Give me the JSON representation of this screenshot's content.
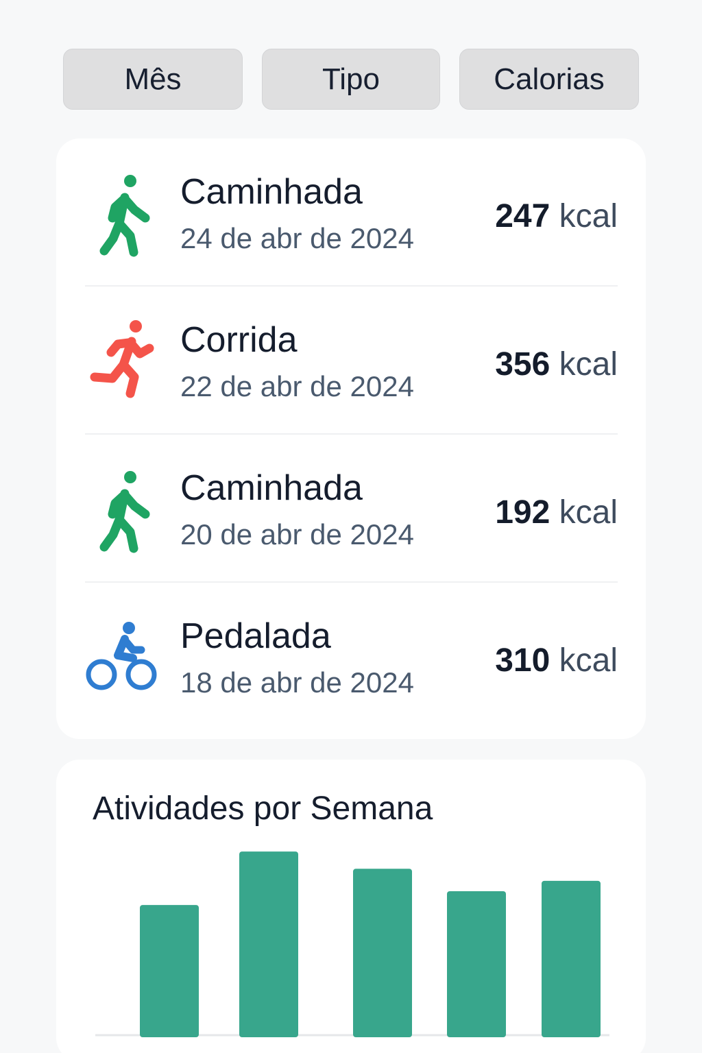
{
  "filters": [
    {
      "label": "Mês"
    },
    {
      "label": "Tipo"
    },
    {
      "label": "Calorias"
    }
  ],
  "activities": [
    {
      "type": "Caminhada",
      "date": "24 de abr de 2024",
      "kcal_value": "247",
      "kcal_unit": "kcal",
      "icon": "walking-icon",
      "color": "#1fa463"
    },
    {
      "type": "Corrida",
      "date": "22 de abr de 2024",
      "kcal_value": "356",
      "kcal_unit": "kcal",
      "icon": "running-icon",
      "color": "#f4544a"
    },
    {
      "type": "Caminhada",
      "date": "20 de abr de 2024",
      "kcal_value": "192",
      "kcal_unit": "kcal",
      "icon": "walking-icon",
      "color": "#1fa463"
    },
    {
      "type": "Pedalada",
      "date": "18 de abr de 2024",
      "kcal_value": "310",
      "kcal_unit": "kcal",
      "icon": "cycling-icon",
      "color": "#2f7dd1"
    }
  ],
  "weekly_chart": {
    "title": "Atividades por Semana",
    "bar_color": "#38a68c"
  },
  "chart_data": {
    "type": "bar",
    "title": "Atividades por Semana",
    "categories": [
      "",
      "",
      "",
      "",
      ""
    ],
    "values": [
      7.5,
      10.6,
      9.6,
      8.3,
      8.9
    ],
    "ylim": [
      0,
      11
    ],
    "grid": false,
    "xlabel": "",
    "ylabel": ""
  }
}
